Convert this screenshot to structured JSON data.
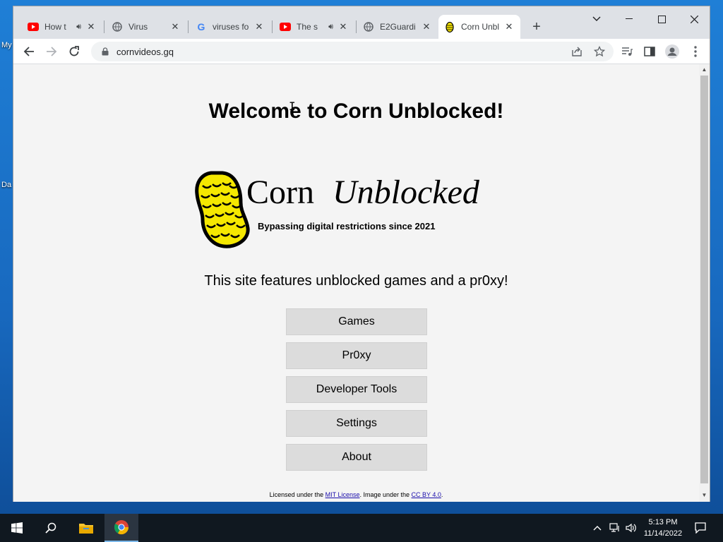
{
  "desktop": {
    "icon_labels": [
      "My",
      "Da"
    ]
  },
  "browser": {
    "tabs": [
      {
        "title": "How t",
        "icon": "youtube-icon",
        "audio": true
      },
      {
        "title": "Virus",
        "icon": "globe-icon",
        "audio": false
      },
      {
        "title": "viruses fo",
        "icon": "google-icon",
        "audio": false
      },
      {
        "title": "The s",
        "icon": "youtube-icon",
        "audio": true
      },
      {
        "title": "E2Guardi",
        "icon": "globe-icon",
        "audio": false
      },
      {
        "title": "Corn Unbl",
        "icon": "corn-icon",
        "audio": false,
        "active": true
      }
    ],
    "url": "cornvideos.gq"
  },
  "page": {
    "heading": "Welcome to Corn Unblocked!",
    "logo": {
      "word1": "Corn",
      "word2": "Unblocked",
      "tagline": "Bypassing digital restrictions since 2021"
    },
    "intro": "This site features unblocked games and a pr0xy!",
    "buttons": [
      "Games",
      "Pr0xy",
      "Developer Tools",
      "Settings",
      "About"
    ],
    "footer": {
      "text1": "Licensed under the ",
      "link1": "MIT License",
      "text2": ". Image under the ",
      "link2": "CC BY 4.0",
      "text3": "."
    }
  },
  "taskbar": {
    "time": "5:13 PM",
    "date": "11/14/2022"
  }
}
